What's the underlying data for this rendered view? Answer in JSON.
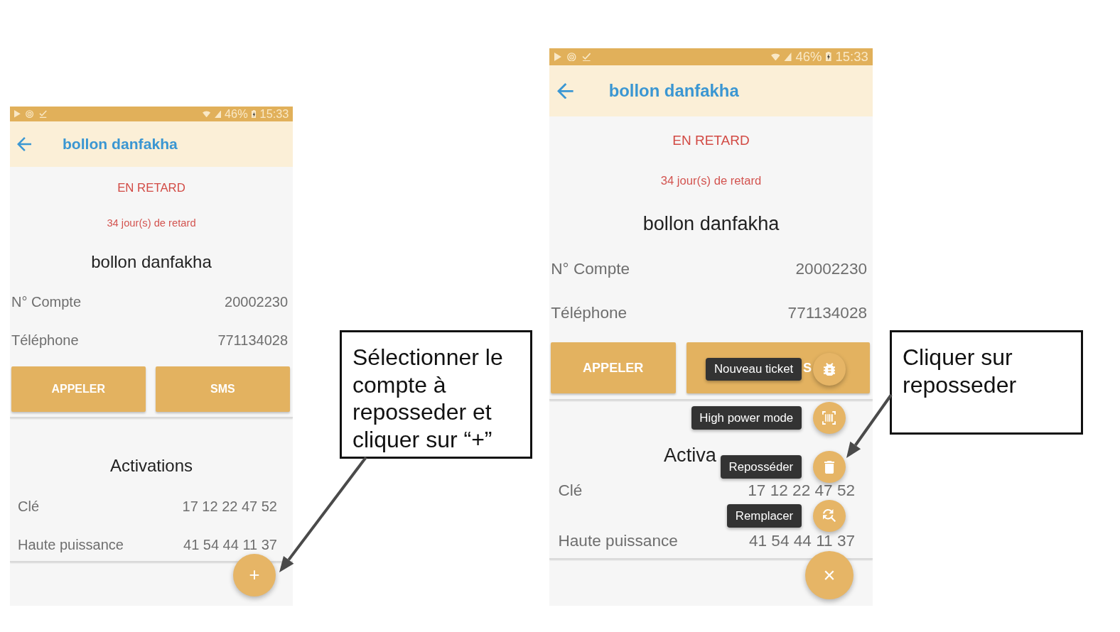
{
  "screens": [
    {
      "status_bar": {
        "battery": "46%",
        "time": "15:33"
      },
      "app_bar": {
        "title": "bollon danfakha"
      },
      "status": "EN RETARD",
      "delay": "34 jour(s) de retard",
      "customer_name": "bollon danfakha",
      "fields": [
        {
          "label": "N° Compte",
          "value": "20002230"
        },
        {
          "label": "Téléphone",
          "value": "771134028"
        }
      ],
      "buttons": [
        {
          "label": "APPELER"
        },
        {
          "label": "SMS"
        }
      ],
      "activations": {
        "title": "Activations",
        "rows": [
          {
            "label": "Clé",
            "value": "17 12 22 47 52"
          },
          {
            "label": "Haute puissance",
            "value": "41 54 44 11 37"
          }
        ]
      },
      "fab": {
        "label": "+",
        "expanded": false
      }
    },
    {
      "status_bar": {
        "battery": "46%",
        "time": "15:33"
      },
      "app_bar": {
        "title": "bollon danfakha"
      },
      "status": "EN RETARD",
      "delay": "34 jour(s) de retard",
      "customer_name": "bollon danfakha",
      "fields": [
        {
          "label": "N° Compte",
          "value": "20002230"
        },
        {
          "label": "Téléphone",
          "value": "771134028"
        }
      ],
      "buttons": [
        {
          "label": "APPELER"
        },
        {
          "label": "S"
        }
      ],
      "activations": {
        "title": "Activa",
        "rows": [
          {
            "label": "Clé",
            "value": "17 12 22 47 52"
          },
          {
            "label": "Haute puissance",
            "value": "41 54 44 11 37"
          }
        ]
      },
      "fab": {
        "label": "×",
        "expanded": true,
        "actions": [
          {
            "label": "Nouveau ticket",
            "kind": "ticket"
          },
          {
            "label": "High power mode",
            "kind": "power"
          },
          {
            "label": "Reposséder",
            "kind": "repossess"
          },
          {
            "label": "Remplacer",
            "kind": "replace"
          }
        ]
      }
    }
  ],
  "callouts": [
    {
      "text": "Sélectionner le compte à reposseder et cliquer sur “+”"
    },
    {
      "text": "Cliquer sur reposseder"
    }
  ]
}
